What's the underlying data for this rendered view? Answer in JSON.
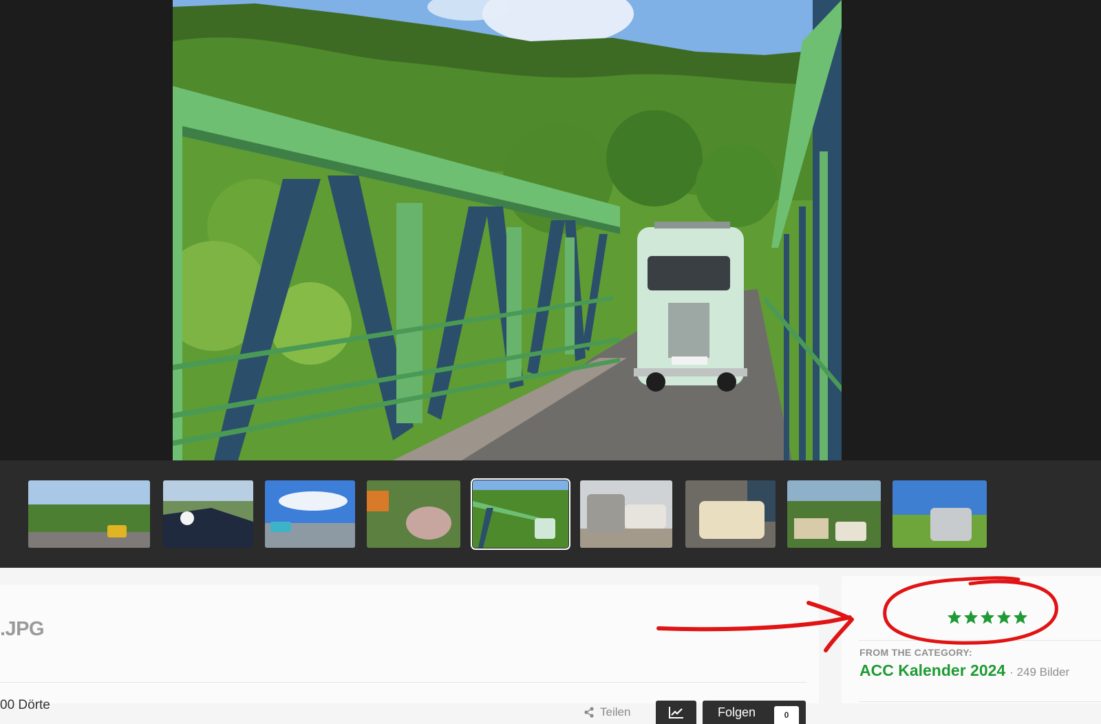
{
  "viewer": {
    "photo_icon": "photo-bridge-van",
    "thumbnails": [
      {
        "icon": "thumb-yellow-van-road"
      },
      {
        "icon": "thumb-wedding-car"
      },
      {
        "icon": "thumb-blue-van-coast"
      },
      {
        "icon": "thumb-2cv-pink"
      },
      {
        "icon": "thumb-van-on-bridge",
        "active": true
      },
      {
        "icon": "thumb-grey-vans"
      },
      {
        "icon": "thumb-cream-van-garage"
      },
      {
        "icon": "thumb-vans-market"
      },
      {
        "icon": "thumb-silver-van-field"
      }
    ]
  },
  "file": {
    "title": ".JPG",
    "author": "00 Dörte"
  },
  "actions": {
    "share_label": "Teilen",
    "follow_label": "Folgen",
    "follow_count": "0"
  },
  "rating": {
    "value": 5,
    "max": 5,
    "color": "#1e9b34"
  },
  "category": {
    "kicker": "FROM THE CATEGORY:",
    "name": "ACC Kalender 2024",
    "count": "· 249 Bilder"
  },
  "colors": {
    "accent": "#1e9b34",
    "annotation": "#e01414",
    "viewer_bg": "#1c1c1c",
    "filmstrip_bg": "#2b2b2b"
  }
}
